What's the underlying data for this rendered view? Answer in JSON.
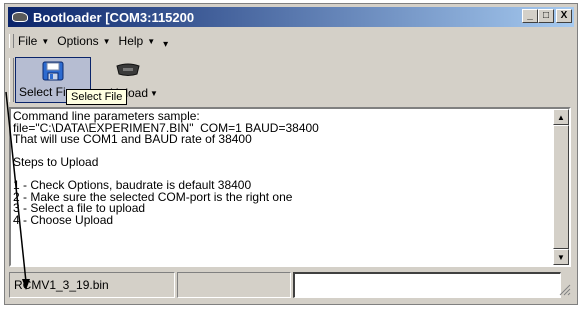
{
  "window": {
    "title": "Bootloader [COM3:115200",
    "controls": {
      "minimize": "_",
      "maximize": "□",
      "close": "X"
    }
  },
  "menu": {
    "items": [
      {
        "label": "File",
        "icon": "caret-down"
      },
      {
        "label": "Options",
        "icon": "caret-down"
      },
      {
        "label": "Help",
        "icon": "caret-down"
      }
    ]
  },
  "toolbar": {
    "select_label": "Select Fi",
    "upload_label": "Upload",
    "select_icon": "floppy-disk-icon",
    "upload_icon": "com-port-icon"
  },
  "tooltip": {
    "text": "Select File"
  },
  "output": {
    "lines": [
      "Command line parameters sample:",
      "file=\"C:\\DATA\\EXPERIMEN7.BIN\"  COM=1 BAUD=38400",
      "That will use COM1 and BAUD rate of 38400",
      "",
      "Steps to Upload",
      "",
      "1 - Check Options, baudrate is default 38400",
      "2 - Make sure the selected COM-port is the right one",
      "3 - Select a file to upload",
      "4 - Choose Upload"
    ]
  },
  "statusbar": {
    "file": "RCMV1_3_19.bin",
    "panel2": "",
    "panel3": ""
  }
}
